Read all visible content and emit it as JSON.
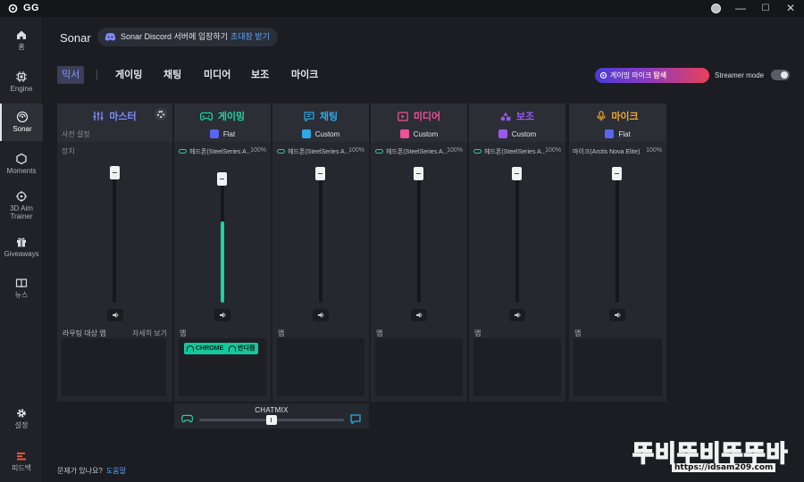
{
  "titlebar": {
    "app_name": "GG",
    "minimize": "—",
    "maximize": "☐",
    "close": "✕"
  },
  "sidebar": {
    "items": [
      {
        "label": "홈",
        "icon": "home-icon"
      },
      {
        "label": "Engine",
        "icon": "chip-icon"
      },
      {
        "label": "Sonar",
        "icon": "sonar-icon",
        "active": true
      },
      {
        "label": "Moments",
        "icon": "hexagon-icon"
      },
      {
        "label": "3D Aim Trainer",
        "icon": "aim-icon"
      },
      {
        "label": "Giveaways",
        "icon": "gift-icon"
      },
      {
        "label": "뉴스",
        "icon": "book-icon"
      },
      {
        "label": "설정",
        "icon": "gear-icon"
      },
      {
        "label": "피드백",
        "icon": "feedback-icon"
      }
    ]
  },
  "header": {
    "title": "Sonar",
    "discord_text": "Sonar Discord 서버에 입장하기",
    "discord_link": "초대장 받기"
  },
  "tabs": [
    "믹서",
    "게이밍",
    "채팅",
    "미디어",
    "보조",
    "마이크"
  ],
  "active_tab": "믹서",
  "stealth": {
    "label": "게이밍 마이크",
    "highlight": "탐색"
  },
  "streamer_mode": {
    "label": "Streamer mode",
    "on": false
  },
  "master": {
    "title": "마스터",
    "preset_label": "사전 설정",
    "device_label": "장치",
    "routing_label": "라우팅 대상 앱",
    "details_link": "자세히 보기",
    "volume": 1.0
  },
  "channels": [
    {
      "title": "게이밍",
      "color": "#1ad3a6",
      "preset": "Flat",
      "preset_color": "#5865f2",
      "device": "헤드폰(SteelSeries A...",
      "percent": "100%",
      "apps_label": "앱",
      "volume": 0.96,
      "level": 0.62,
      "apps": [
        "CHROME",
        "반디캠"
      ]
    },
    {
      "title": "채팅",
      "color": "#2fa8e8",
      "preset": "Custom",
      "preset_color": "#2fa8e8",
      "device": "헤드폰(SteelSeries A...",
      "percent": "100%",
      "apps_label": "앱",
      "volume": 1.0,
      "level": 0,
      "apps": []
    },
    {
      "title": "미디어",
      "color": "#f0509a",
      "preset": "Custom",
      "preset_color": "#f0509a",
      "device": "헤드폰(SteelSeries A...",
      "percent": "100%",
      "apps_label": "앱",
      "volume": 1.0,
      "level": 0,
      "apps": []
    },
    {
      "title": "보조",
      "color": "#9a58f0",
      "preset": "Custom",
      "preset_color": "#9a58f0",
      "device": "헤드폰(SteelSeries A...",
      "percent": "100%",
      "apps_label": "앱",
      "volume": 1.0,
      "level": 0,
      "apps": []
    },
    {
      "title": "마이크",
      "color": "#f0a830",
      "preset": "Flat",
      "preset_color": "#5865f2",
      "device": "마이크(Arctis Nova Elite)",
      "percent": "100%",
      "apps_label": "앱",
      "volume": 1.0,
      "level": 0,
      "apps": []
    }
  ],
  "chatmix": {
    "title": "CHATMIX",
    "position": 0.5
  },
  "footer": {
    "question": "문제가 있나요?",
    "help_link": "도움말"
  },
  "watermark": {
    "text": "뚜비뚜비뚜뚜바",
    "url": "https://idsam209.com"
  }
}
